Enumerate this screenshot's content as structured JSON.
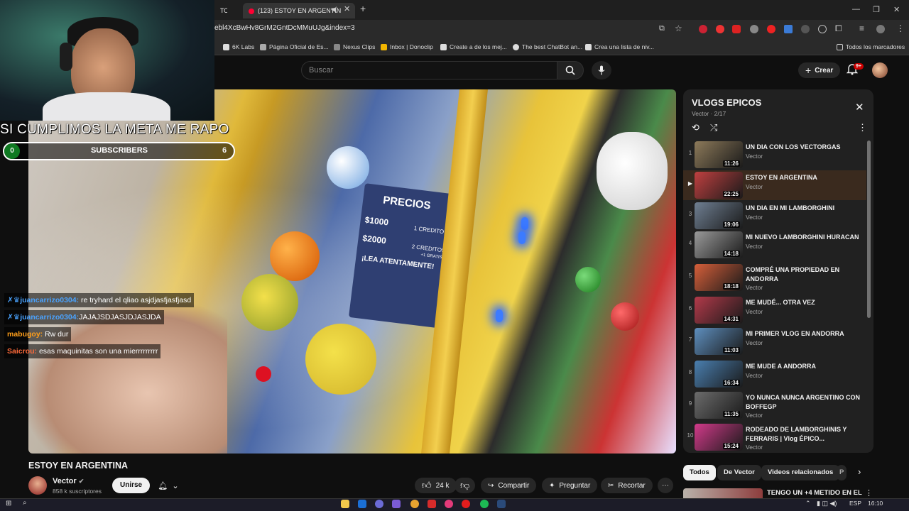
{
  "browser": {
    "tabs": [
      {
        "label": "ТО"
      },
      {
        "label": "(123) ESTOY EN ARGENTIN"
      }
    ],
    "url": "ebl4XcBwHv8GrM2GntDcMMuUJg&index=3",
    "bookmarks": [
      {
        "label": "6K Labs"
      },
      {
        "label": "Página Oficial de Es..."
      },
      {
        "label": "Nexus Clips"
      },
      {
        "label": "Inbox | Donoclip"
      },
      {
        "label": "Create a de los mej..."
      },
      {
        "label": "The best ChatBot an..."
      },
      {
        "label": "Crea una lista de niv..."
      }
    ],
    "all_bookmarks": "Todos los marcadores"
  },
  "header": {
    "search_placeholder": "Buscar",
    "create_label": "Crear",
    "notif_count": "9+"
  },
  "overlay": {
    "goal_text": "SI CUMPLIMOS LA META ME RAPO",
    "sub_start": "0",
    "sub_label": "SUBSCRIBERS",
    "sub_end": "6",
    "chat": [
      {
        "user": "juancarrizo0304:",
        "text": "re tryhard el qliao asjdjasfjasfjasd",
        "color": "#4aa3ff"
      },
      {
        "user": "juancarrizo0304:",
        "text": "JAJAJSDJASJDJASJDA",
        "color": "#4aa3ff"
      },
      {
        "user": "mabugoy:",
        "text": "Rw dur",
        "color": "#ff9f1a"
      },
      {
        "user": "Saicrou:",
        "text": "esas maquinitas son una mierrrrrrrrr",
        "color": "#ff6a3a"
      }
    ]
  },
  "video_text": {
    "sign_title": "PRECIOS",
    "sign_price1": "$1000",
    "sign_price1_desc": "1 CREDITO",
    "sign_price2": "$2000",
    "sign_price2_desc": "2 CREDITOS",
    "sign_bonus": "+1 GRATIS",
    "sign_note": "¡LEA ATENTAMENTE!"
  },
  "video": {
    "title": "ESTOY EN ARGENTINA",
    "channel": "Vector",
    "subs": "858 k suscriptores",
    "join_label": "Unirse",
    "likes": "24 k",
    "share_label": "Compartir",
    "ask_label": "Preguntar",
    "clip_label": "Recortar"
  },
  "playlist": {
    "title": "VLOGS EPICOS",
    "subtitle": "Vector · 2/17",
    "items": [
      {
        "index": "1",
        "title": "UN DIA CON LOS VECTORGAS",
        "channel": "Vector",
        "duration": "11:26",
        "thumb_color": "#8d7a5a"
      },
      {
        "index": "",
        "title": "ESTOY EN ARGENTINA",
        "channel": "Vector",
        "duration": "22:25",
        "thumb_color": "#c04040"
      },
      {
        "index": "3",
        "title": "UN DIA EN MI LAMBORGHINI",
        "channel": "Vector",
        "duration": "19:06",
        "thumb_color": "#6f7f92"
      },
      {
        "index": "4",
        "title": "MI NUEVO LAMBORGHINI HURACAN",
        "channel": "Vector",
        "duration": "14:18",
        "thumb_color": "#9a9a9a"
      },
      {
        "index": "5",
        "title": "COMPRÉ UNA PROPIEDAD EN ANDORRA",
        "channel": "Vector",
        "duration": "18:18",
        "thumb_color": "#d65f3a"
      },
      {
        "index": "6",
        "title": "ME MUDÉ... OTRA VEZ",
        "channel": "Vector",
        "duration": "14:31",
        "thumb_color": "#b33a4a"
      },
      {
        "index": "7",
        "title": "MI PRIMER VLOG EN ANDORRA",
        "channel": "Vector",
        "duration": "11:03",
        "thumb_color": "#5e8fbf"
      },
      {
        "index": "8",
        "title": "ME MUDE A ANDORRA",
        "channel": "Vector",
        "duration": "16:34",
        "thumb_color": "#4a7fb0"
      },
      {
        "index": "9",
        "title": "YO NUNCA NUNCA ARGENTINO CON BOFFEGP",
        "channel": "Vector",
        "duration": "11:35",
        "thumb_color": "#6c6c6c"
      },
      {
        "index": "10",
        "title": "RODEADO DE LAMBORGHINIS Y FERRARIS | Vlog ÉPICO...",
        "channel": "Vector",
        "duration": "15:24",
        "thumb_color": "#d23a8a"
      }
    ]
  },
  "chips": [
    {
      "label": "Todos"
    },
    {
      "label": "De Vector"
    },
    {
      "label": "Videos relacionados"
    },
    {
      "label": "P"
    }
  ],
  "next_video_title": "TENGO UN +4 METIDO EN EL",
  "taskbar": {
    "lang": "ESP",
    "time": "16:10"
  }
}
